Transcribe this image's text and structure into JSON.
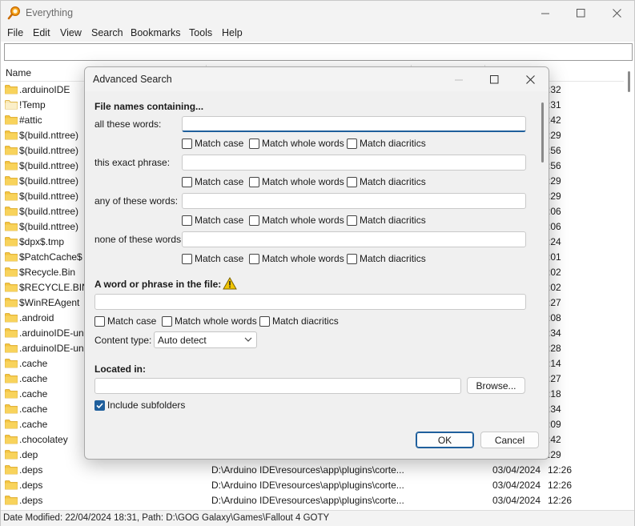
{
  "app": {
    "title": "Everything"
  },
  "menu": [
    "File",
    "Edit",
    "View",
    "Search",
    "Bookmarks",
    "Tools",
    "Help"
  ],
  "search": {
    "value": ""
  },
  "list": {
    "header_name": "Name",
    "rows": [
      {
        "name": ".arduinoIDE",
        "path": "",
        "date": "",
        "time": ":32"
      },
      {
        "name": "!Temp",
        "path": "",
        "date": "",
        "time": ":31"
      },
      {
        "name": "#attic",
        "path": "",
        "date": "",
        "time": ":42"
      },
      {
        "name": "$(build.nttree)",
        "path": "",
        "date": "",
        "time": ":29"
      },
      {
        "name": "$(build.nttree)",
        "path": "",
        "date": "",
        "time": ":56"
      },
      {
        "name": "$(build.nttree)",
        "path": "",
        "date": "",
        "time": ":56"
      },
      {
        "name": "$(build.nttree)",
        "path": "",
        "date": "",
        "time": ":29"
      },
      {
        "name": "$(build.nttree)",
        "path": "",
        "date": "",
        "time": ":29"
      },
      {
        "name": "$(build.nttree)",
        "path": "",
        "date": "",
        "time": ":06"
      },
      {
        "name": "$(build.nttree)",
        "path": "",
        "date": "",
        "time": ":06"
      },
      {
        "name": "$dpx$.tmp",
        "path": "",
        "date": "",
        "time": ":24"
      },
      {
        "name": "$PatchCache$",
        "path": "",
        "date": "",
        "time": ":01"
      },
      {
        "name": "$Recycle.Bin",
        "path": "",
        "date": "",
        "time": ":02"
      },
      {
        "name": "$RECYCLE.BIN",
        "path": "",
        "date": "",
        "time": ":02"
      },
      {
        "name": "$WinREAgent",
        "path": "",
        "date": "",
        "time": ":27"
      },
      {
        "name": ".android",
        "path": "",
        "date": "",
        "time": ":08"
      },
      {
        "name": ".arduinoIDE-uns",
        "path": "",
        "date": "",
        "time": ":34"
      },
      {
        "name": ".arduinoIDE-uns",
        "path": "",
        "date": "",
        "time": ":28"
      },
      {
        "name": ".cache",
        "path": "",
        "date": "",
        "time": ":14"
      },
      {
        "name": ".cache",
        "path": "",
        "date": "",
        "time": ":27"
      },
      {
        "name": ".cache",
        "path": "",
        "date": "",
        "time": ":18"
      },
      {
        "name": ".cache",
        "path": "",
        "date": "",
        "time": ":34"
      },
      {
        "name": ".cache",
        "path": "",
        "date": "",
        "time": ":09"
      },
      {
        "name": ".chocolatey",
        "path": "",
        "date": "",
        "time": ":42"
      },
      {
        "name": ".dep",
        "path": "",
        "date": "",
        "time": ":29"
      },
      {
        "name": ".deps",
        "path": "D:\\Arduino IDE\\resources\\app\\plugins\\corte...",
        "date": "03/04/2024",
        "time": "12:26"
      },
      {
        "name": ".deps",
        "path": "D:\\Arduino IDE\\resources\\app\\plugins\\corte...",
        "date": "03/04/2024",
        "time": "12:26"
      },
      {
        "name": ".deps",
        "path": "D:\\Arduino IDE\\resources\\app\\plugins\\corte...",
        "date": "03/04/2024",
        "time": "12:26"
      }
    ]
  },
  "status": "Date Modified: 22/04/2024 18:31, Path: D:\\GOG Galaxy\\Games\\Fallout 4 GOTY",
  "dialog": {
    "title": "Advanced Search",
    "filenames_heading": "File names containing...",
    "fields": [
      {
        "label": "all these words:",
        "value": ""
      },
      {
        "label": "this exact phrase:",
        "value": ""
      },
      {
        "label": "any of these words:",
        "value": ""
      },
      {
        "label": "none of these words:",
        "value": ""
      }
    ],
    "opt_case": "Match case",
    "opt_whole": "Match whole words",
    "opt_diacritics": "Match diacritics",
    "content_heading": "A word or phrase in the file:",
    "content_value": "",
    "content_type_label": "Content type:",
    "content_type_value": "Auto detect",
    "located_heading": "Located in:",
    "located_value": "",
    "browse_label": "Browse...",
    "include_subfolders_label": "Include subfolders",
    "include_subfolders_checked": true,
    "ok_label": "OK",
    "cancel_label": "Cancel",
    "accent_color": "#1f5f9c",
    "warning_color": "#f2c500"
  }
}
